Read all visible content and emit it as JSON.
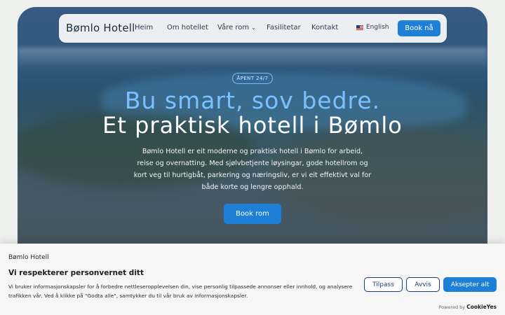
{
  "nav": {
    "brand": "Bømlo Hotell",
    "links": [
      "Heim",
      "Om hotellet",
      "Våre rom",
      "Fasilitetar",
      "Kontakt"
    ],
    "language": "English",
    "book_button": "Book nå"
  },
  "hero": {
    "badge": "ÅPENT 24/7",
    "title_line1": "Bu smart, sov bedre.",
    "title_line2": "Et praktisk hotell i Bømlo",
    "description": "Bømlo Hotell er eit moderne og praktisk hotell i Bømlo for arbeid, reise og overnatting. Med sjølvbetjente løysingar, gode hotellrom og kort veg til hurtigbåt, parkering og næringsliv, er vi eit effektivt val for både korte og lengre opphald.",
    "book_button": "Book rom"
  },
  "cookie": {
    "brand": "Bømlo Hotell",
    "title": "Vi respekterer personvernet ditt",
    "text": "Vi bruker informasjonskapsler for å forbedre nettleseropplevelsen din, vise personlig tilpassede annonser eller innhold, og analysere trafikken vår. Ved å klikke på \"Godta alle\", samtykker du til vår bruk av informasjonskapsler.",
    "customize": "Tilpass",
    "reject": "Avvis",
    "accept": "Aksepter alt",
    "powered_by": "Powered by",
    "powered_brand": "CookieYes"
  },
  "colors": {
    "accent": "#1e7fd6",
    "title_blue": "#7cc1ff",
    "outline": "#1c3e70"
  }
}
